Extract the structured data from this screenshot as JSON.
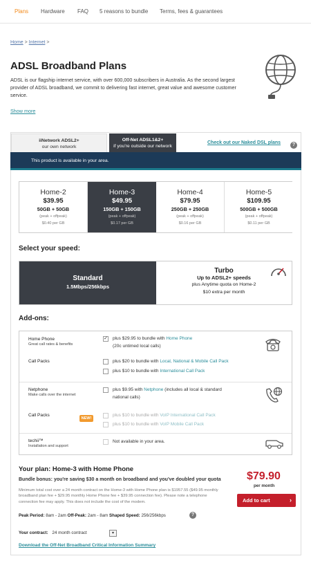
{
  "nav": {
    "items": [
      "Plans",
      "Hardware",
      "FAQ",
      "5 reasons to bundle",
      "Terms, fees & guarantees"
    ]
  },
  "breadcrumb": {
    "home": "Home",
    "sep1": " > ",
    "internet": "Internet",
    "sep2": " >"
  },
  "page": {
    "title": "ADSL Broadband Plans",
    "intro": "ADSL is our flagship internet service, with over 600,000 subscribers in Australia. As the second largest provider of ADSL broadband, we commit to delivering fast internet, great value and awesome customer service.",
    "show_more": "Show more"
  },
  "tabs": {
    "tab1_title": "iiNetwork ADSL2+",
    "tab1_sub": "our own network",
    "tab2_title": "Off-Net ADSL1&2+",
    "tab2_sub": "if you're outside our network",
    "naked_link": "Check out our Naked DSL plans"
  },
  "availability": "This product is available in your area.",
  "plans": [
    {
      "name": "Home-2",
      "price": "$39.95",
      "quota": "50GB + 50GB",
      "note1": "(peak + offpeak)",
      "note2": "$0.40 per GB"
    },
    {
      "name": "Home-3",
      "price": "$49.95",
      "quota": "150GB + 150GB",
      "note1": "(peak + offpeak)",
      "note2": "$0.17 per GB"
    },
    {
      "name": "Home-4",
      "price": "$79.95",
      "quota": "250GB + 250GB",
      "note1": "(peak + offpeak)",
      "note2": "$0.16 per GB"
    },
    {
      "name": "Home-5",
      "price": "$109.95",
      "quota": "500GB + 500GB",
      "note1": "(peak + offpeak)",
      "note2": "$0.11 per GB"
    }
  ],
  "speed": {
    "heading": "Select your speed:",
    "standard_title": "Standard",
    "standard_sub": "1.5Mbps/256kbps",
    "turbo_title": "Turbo",
    "turbo_sub": "Up to ADSL2+ speeds",
    "turbo_note1": "plus Anytime quota on Home-2",
    "turbo_note2": "$10 extra per month"
  },
  "addons": {
    "heading": "Add-ons:",
    "home_phone": {
      "title": "Home Phone",
      "sub": "Great call rates & benefits",
      "opt_prefix": "plus $29.95 to bundle with ",
      "opt_link": "Home Phone",
      "opt_note": "(20c untimed local calls)",
      "checked": "✓"
    },
    "call_packs": {
      "title": "Call Packs",
      "opt1_prefix": "plus $20 to bundle with ",
      "opt1_link": "Local, National & Mobile Call Pack",
      "opt2_prefix": "plus $10 to bundle with ",
      "opt2_link": "International Call Pack"
    },
    "netphone": {
      "title": "Netphone",
      "sub": "Make calls over the internet",
      "opt_prefix": "plus $9.95 with ",
      "opt_link": "Netphone",
      "opt_suffix": " (includes all local & standard",
      "opt_line2": "national calls)"
    },
    "np_call_packs": {
      "title": "Call Packs",
      "badge": "NEW!",
      "opt1_prefix": "plus $10 to bundle with ",
      "opt1_link": "VoIP International Call Pack",
      "opt2_prefix": "plus $10 to bundle with ",
      "opt2_link": "VoIP Mobile Call Pack"
    },
    "techii": {
      "title": "techii™",
      "sub": "Installation and support",
      "opt": "Not available in your area."
    }
  },
  "summary": {
    "title": "Your plan: Home-3 with Home Phone",
    "bonus": "Bundle bonus: you're saving $30 a month on broadband and you've doubled your quota",
    "fine": "Minimum total cost over a 24 month contract on the Home-3 with Home Phone plan is $1957.55 ($49.95 monthly broadband plan fee + $29.95 monthly Home Phone fee + $39.95 connection fee). Please note a telephone connection fee may apply. This does not include the cost of the modem.",
    "peak_label": "Peak Period:",
    "peak_val": " 8am - 2am ",
    "offpeak_label": "Off-Peak:",
    "offpeak_val": " 2am - 8am ",
    "shaped_label": "Shaped Speed:",
    "shaped_val": " 256/256kbps",
    "contract_label": "Your contract:",
    "contract_val": "24 month contract",
    "cis_link": "Download the Off-Net Broadband Critical Information Summary",
    "total": "$79.90",
    "per_month": "per month",
    "cart": "Add to cart",
    "cart_arrow": "›"
  }
}
